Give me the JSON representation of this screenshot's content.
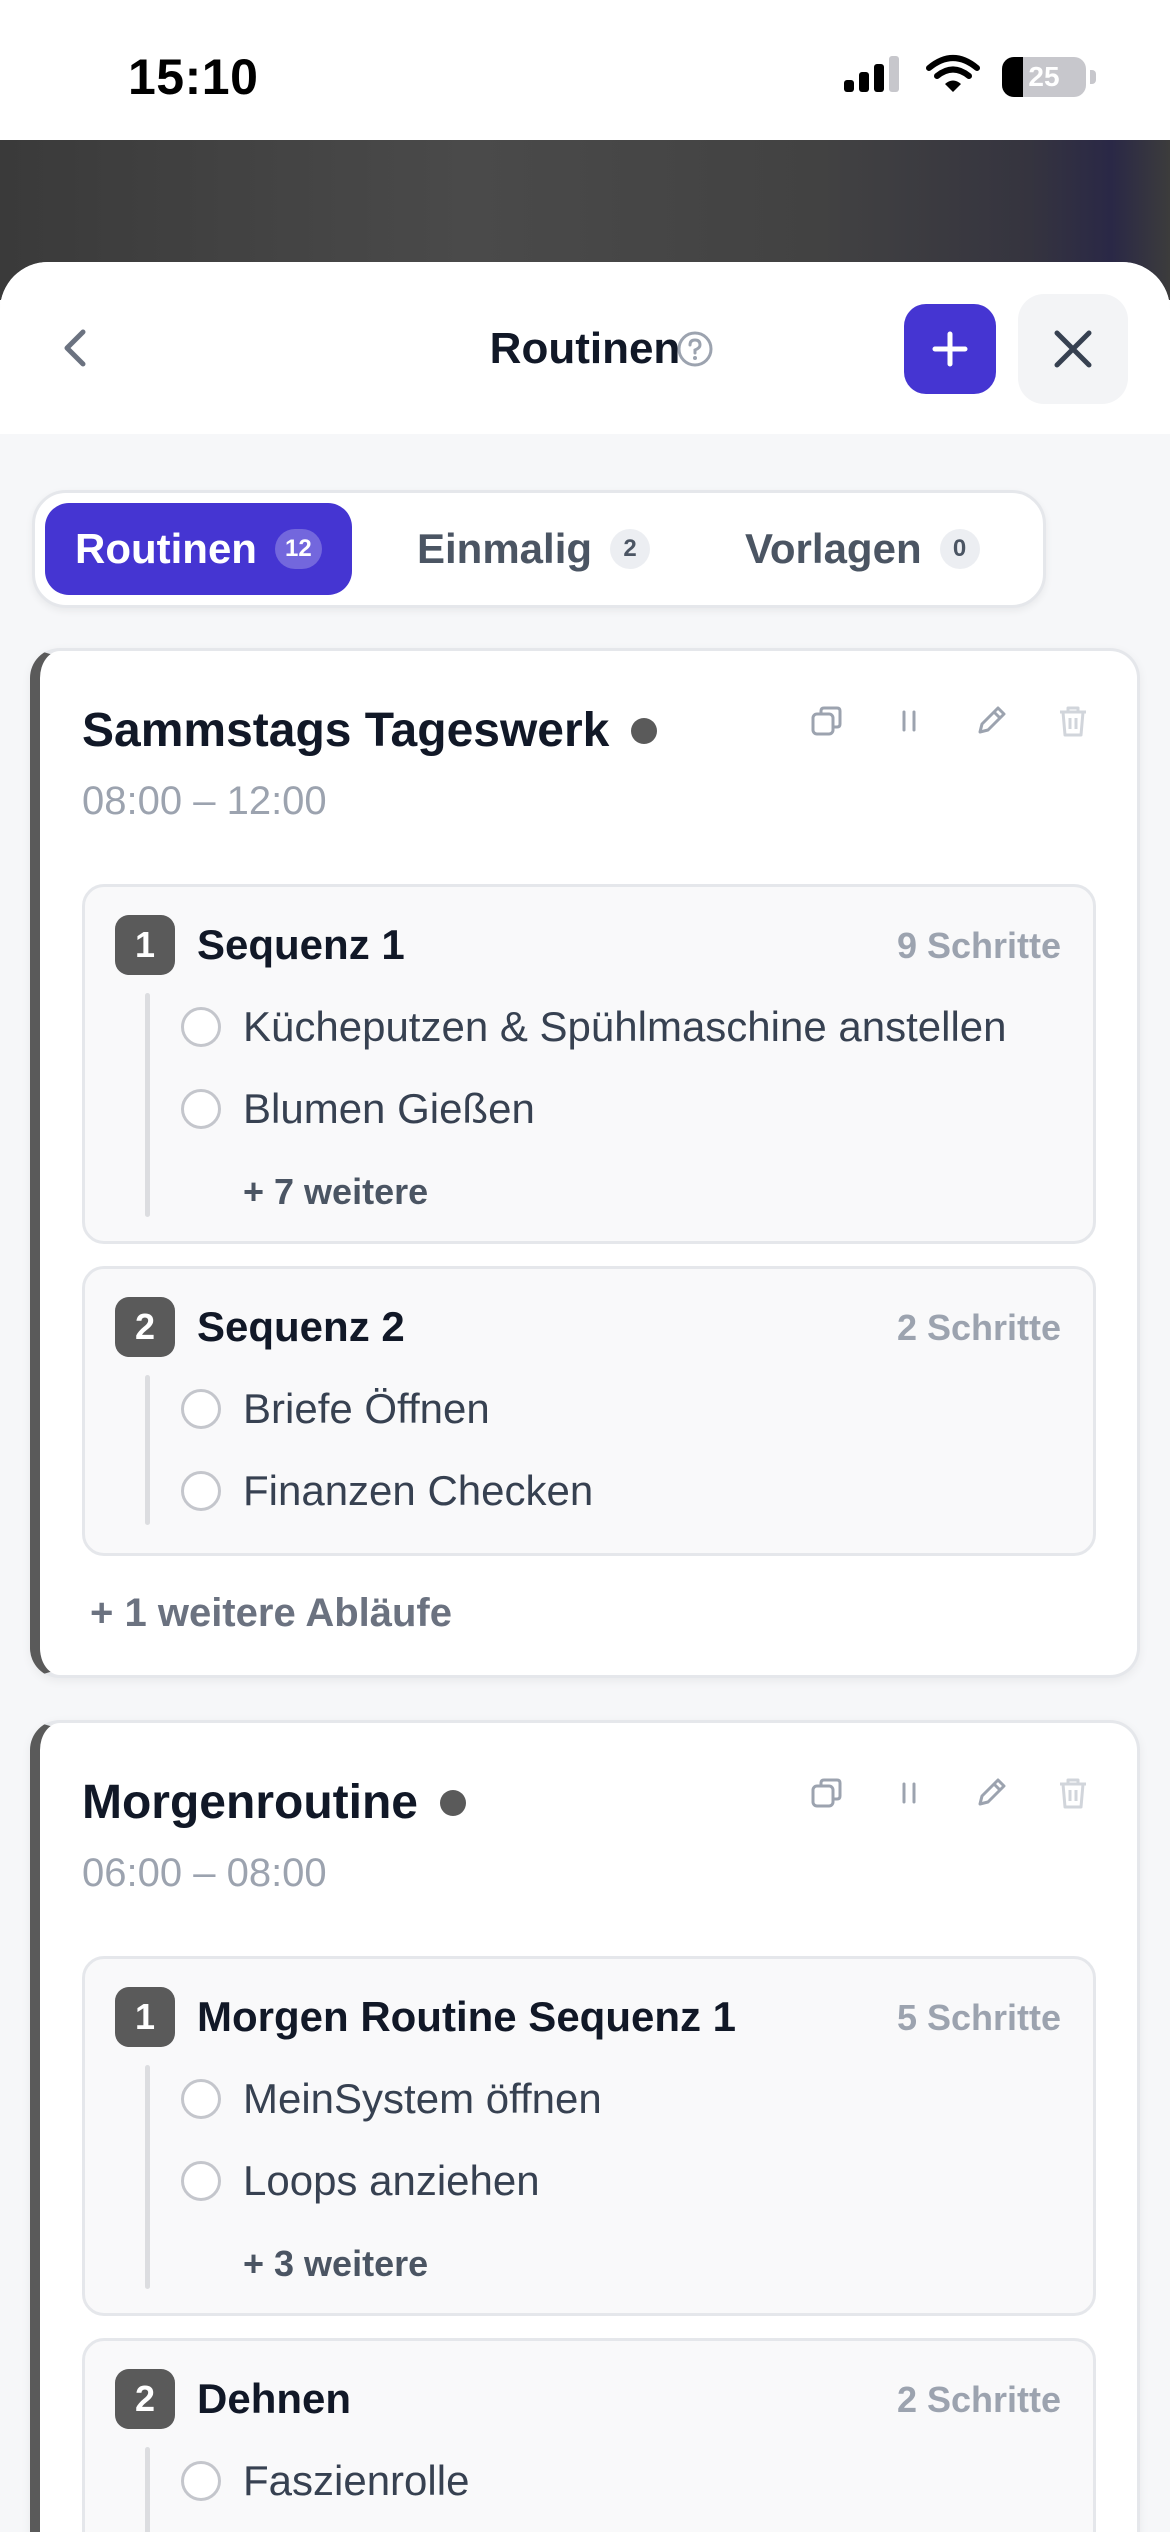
{
  "status_bar": {
    "time": "15:10",
    "battery": "25",
    "battery_level": 0.25
  },
  "header": {
    "title": "Routinen"
  },
  "tabs": [
    {
      "label": "Routinen",
      "count": "12",
      "active": true
    },
    {
      "label": "Einmalig",
      "count": "2",
      "active": false
    },
    {
      "label": "Vorlagen",
      "count": "0",
      "active": false
    }
  ],
  "routines": [
    {
      "title": "Sammstags Tageswerk",
      "time": "08:00 – 12:00",
      "sequences": [
        {
          "number": "1",
          "title": "Sequenz 1",
          "count": "9 Schritte",
          "steps": [
            "Kücheputzen & Spühlmaschine anstellen",
            "Blumen Gießen"
          ],
          "more": "+ 7 weitere"
        },
        {
          "number": "2",
          "title": "Sequenz 2",
          "count": "2 Schritte",
          "steps": [
            "Briefe Öffnen",
            "Finanzen Checken"
          ]
        }
      ],
      "more_sequences": "+ 1 weitere Abläufe"
    },
    {
      "title": "Morgenroutine",
      "time": "06:00 – 08:00",
      "sequences": [
        {
          "number": "1",
          "title": "Morgen Routine Sequenz 1",
          "count": "5 Schritte",
          "steps": [
            "MeinSystem öffnen",
            "Loops anziehen"
          ],
          "more": "+ 3 weitere"
        },
        {
          "number": "2",
          "title": "Dehnen",
          "count": "2 Schritte",
          "steps": [
            "Faszienrolle"
          ]
        }
      ]
    }
  ],
  "colors": {
    "accent": "#4535d2",
    "card_stripe": "#5a5a5a"
  }
}
